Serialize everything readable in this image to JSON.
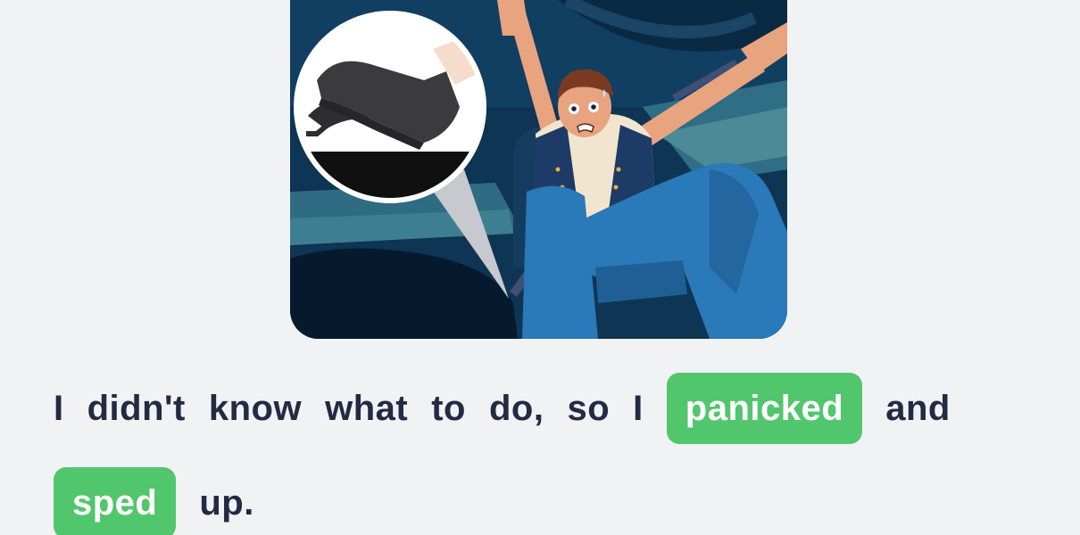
{
  "illustration": {
    "alt": "",
    "colors": {
      "cabin": "#0f3a5a",
      "jeans": "#2a79b8",
      "vest": "#1d3b66",
      "skin": "#e8a37f",
      "shoe": "#3b3b3d"
    }
  },
  "sentence": {
    "line1": [
      "I",
      "didn't",
      "know",
      "what",
      "to",
      "do,",
      "so",
      "I"
    ],
    "chip1": "panicked",
    "after_chip1": "and",
    "chip2": "sped",
    "after_chip2": "up."
  },
  "colors": {
    "chip_bg": "#52c66d",
    "chip_text": "#ffffff",
    "text": "#232a44",
    "background": "#f1f2f4"
  }
}
